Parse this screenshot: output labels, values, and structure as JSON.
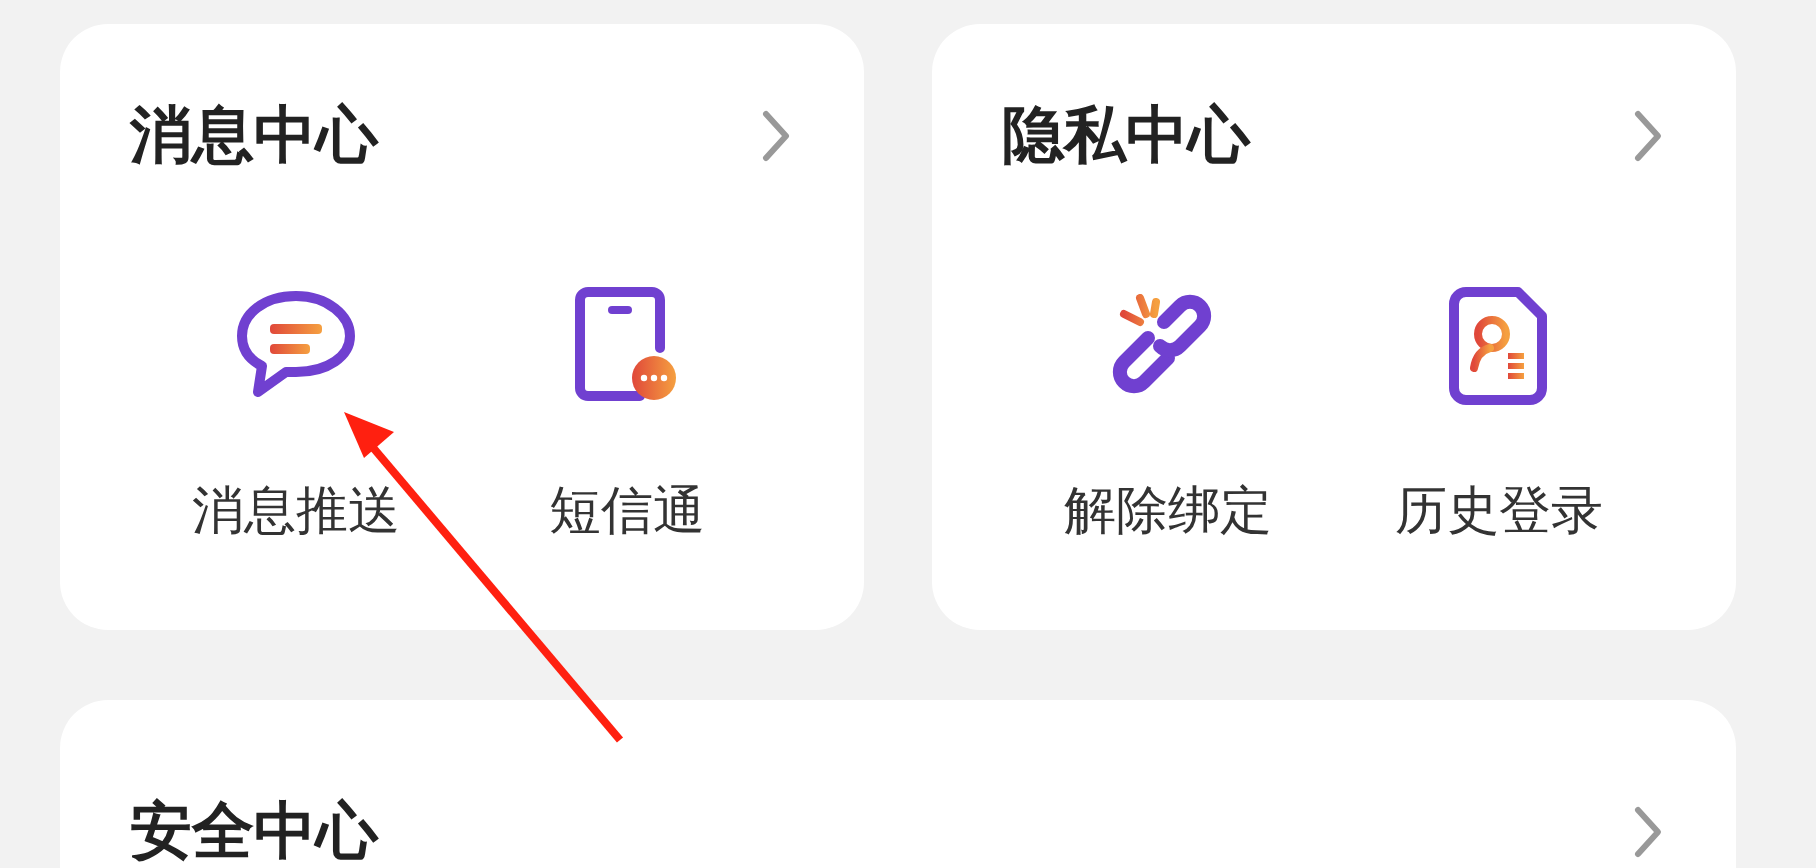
{
  "cards": [
    {
      "title": "消息中心",
      "items": [
        {
          "kind": "message",
          "label": "消息推送"
        },
        {
          "kind": "phone",
          "label": "短信通"
        }
      ]
    },
    {
      "title": "隐私中心",
      "items": [
        {
          "kind": "unlink",
          "label": "解除绑定"
        },
        {
          "kind": "record",
          "label": "历史登录"
        }
      ]
    },
    {
      "title": "安全中心"
    }
  ]
}
